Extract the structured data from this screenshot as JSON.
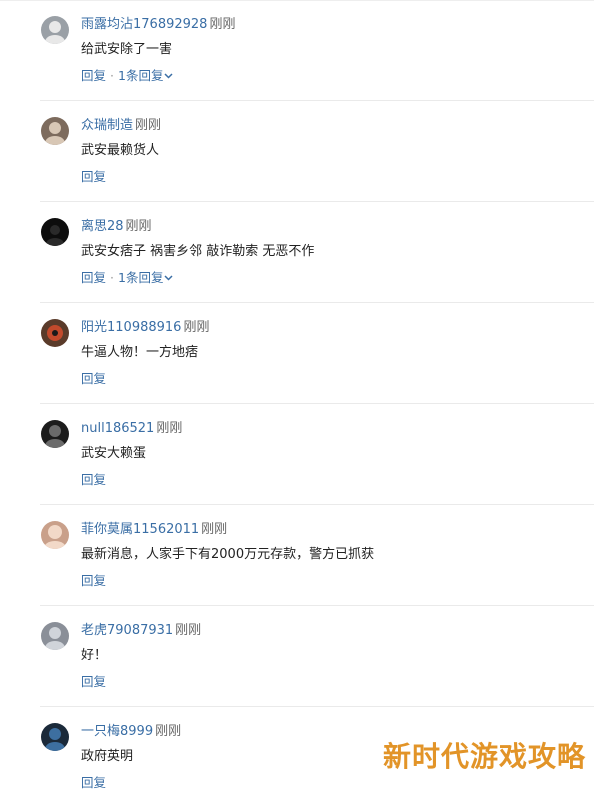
{
  "comments": [
    {
      "username": "雨露均沾176892928",
      "time": "刚刚",
      "content": "给武安除了一害",
      "reply_label": "回复",
      "separator": "·",
      "replies_label": "1条回复",
      "avatar_colors": [
        "#9aa0a6",
        "#e8e8e8"
      ]
    },
    {
      "username": "众瑞制造",
      "time": "刚刚",
      "content": "武安最赖货人",
      "reply_label": "回复",
      "separator": "",
      "replies_label": "",
      "avatar_colors": [
        "#7d6b5d",
        "#d8c7b5"
      ]
    },
    {
      "username": "离思28",
      "time": "刚刚",
      "content": "武安女痞子 祸害乡邻 敲诈勒索 无恶不作",
      "reply_label": "回复",
      "separator": "·",
      "replies_label": "1条回复",
      "avatar_colors": [
        "#0d0d0d",
        "#2a2a2a"
      ]
    },
    {
      "username": "阳光110988916",
      "time": "刚刚",
      "content": "牛逼人物！一方地痞",
      "reply_label": "回复",
      "separator": "",
      "replies_label": "",
      "avatar_colors": [
        "#5a3b2a",
        "#c24a2c"
      ]
    },
    {
      "username": "null186521",
      "time": "刚刚",
      "content": "武安大赖蛋",
      "reply_label": "回复",
      "separator": "",
      "replies_label": "",
      "avatar_colors": [
        "#1c1c1c",
        "#6b6b6b"
      ]
    },
    {
      "username": "菲你莫属11562011",
      "time": "刚刚",
      "content": "最新消息，人家手下有2000万元存款，警方已抓获",
      "reply_label": "回复",
      "separator": "",
      "replies_label": "",
      "avatar_colors": [
        "#c9a08a",
        "#f2d9c8"
      ]
    },
    {
      "username": "老虎79087931",
      "time": "刚刚",
      "content": "好！",
      "reply_label": "回复",
      "separator": "",
      "replies_label": "",
      "avatar_colors": [
        "#8a8f98",
        "#d0d4da"
      ]
    },
    {
      "username": "一只梅8999",
      "time": "刚刚",
      "content": "政府英明",
      "reply_label": "回复",
      "separator": "",
      "replies_label": "",
      "avatar_colors": [
        "#1b2a3a",
        "#3d6fa0"
      ]
    }
  ],
  "watermark": "新时代游戏攻略",
  "colors": {
    "username": "#3a6ea5",
    "action": "#3a6ea5",
    "text": "#222222",
    "time": "#666666",
    "watermark": "#e29428"
  }
}
